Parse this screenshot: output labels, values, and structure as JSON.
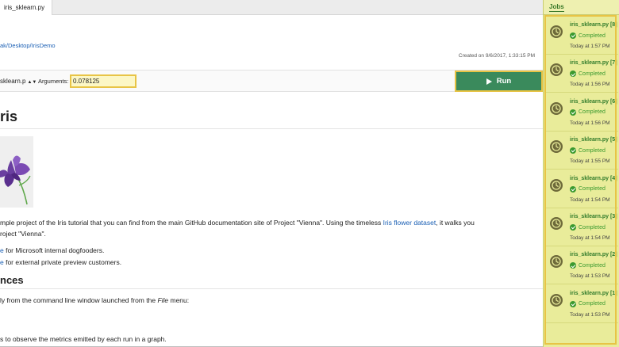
{
  "tab": {
    "label": "iris_sklearn.py"
  },
  "header": {
    "path": "ak/Desktop/IrisDemo",
    "created": "Created on 9/6/2017, 1:33:15 PM"
  },
  "runbar": {
    "script": "sklearn.p",
    "arguments_label": "Arguments:",
    "arguments_value": "0.078125",
    "run_label": "Run"
  },
  "doc": {
    "title": "ris",
    "p1_a": "mple project of the Iris tutorial that you can find from the main GitHub documentation site of Project \"Vienna\". Using the timeless ",
    "p1_link": "Iris flower dataset",
    "p1_b": ", it walks you",
    "p1_cont": "roject \"Vienna\".",
    "li1_link": "e",
    "li1_text": " for Microsoft internal dogfooders.",
    "li2_link": "e",
    "li2_text": " for external private preview customers.",
    "h2": "nces",
    "p2_a": "ly from the command line window launched from the ",
    "p2_em": "File",
    "p2_b": " menu:",
    "p3": "s to observe the metrics emitted by each run in a graph."
  },
  "jobs": {
    "title": "Jobs",
    "items": [
      {
        "name": "iris_sklearn.py [8]",
        "status": "Completed",
        "time": "Today at 1:57 PM"
      },
      {
        "name": "iris_sklearn.py [7]",
        "status": "Completed",
        "time": "Today at 1:56 PM"
      },
      {
        "name": "iris_sklearn.py [6]",
        "status": "Completed",
        "time": "Today at 1:56 PM"
      },
      {
        "name": "iris_sklearn.py [5]",
        "status": "Completed",
        "time": "Today at 1:55 PM"
      },
      {
        "name": "iris_sklearn.py [4]",
        "status": "Completed",
        "time": "Today at 1:54 PM"
      },
      {
        "name": "iris_sklearn.py [3]",
        "status": "Completed",
        "time": "Today at 1:54 PM"
      },
      {
        "name": "iris_sklearn.py [2]",
        "status": "Completed",
        "time": "Today at 1:53 PM"
      },
      {
        "name": "iris_sklearn.py [1]",
        "status": "Completed",
        "time": "Today at 1:53 PM"
      }
    ]
  },
  "icons": {
    "play": "play-icon",
    "clock": "clock-icon",
    "check": "check-circle-icon",
    "image": "iris-flower-image"
  },
  "colors": {
    "run_button": "#3a8a5c",
    "jobs_panel": "#e9ec9a",
    "highlight": "#e8c446",
    "link": "#1a5fb4",
    "completed": "#3b9a30"
  }
}
